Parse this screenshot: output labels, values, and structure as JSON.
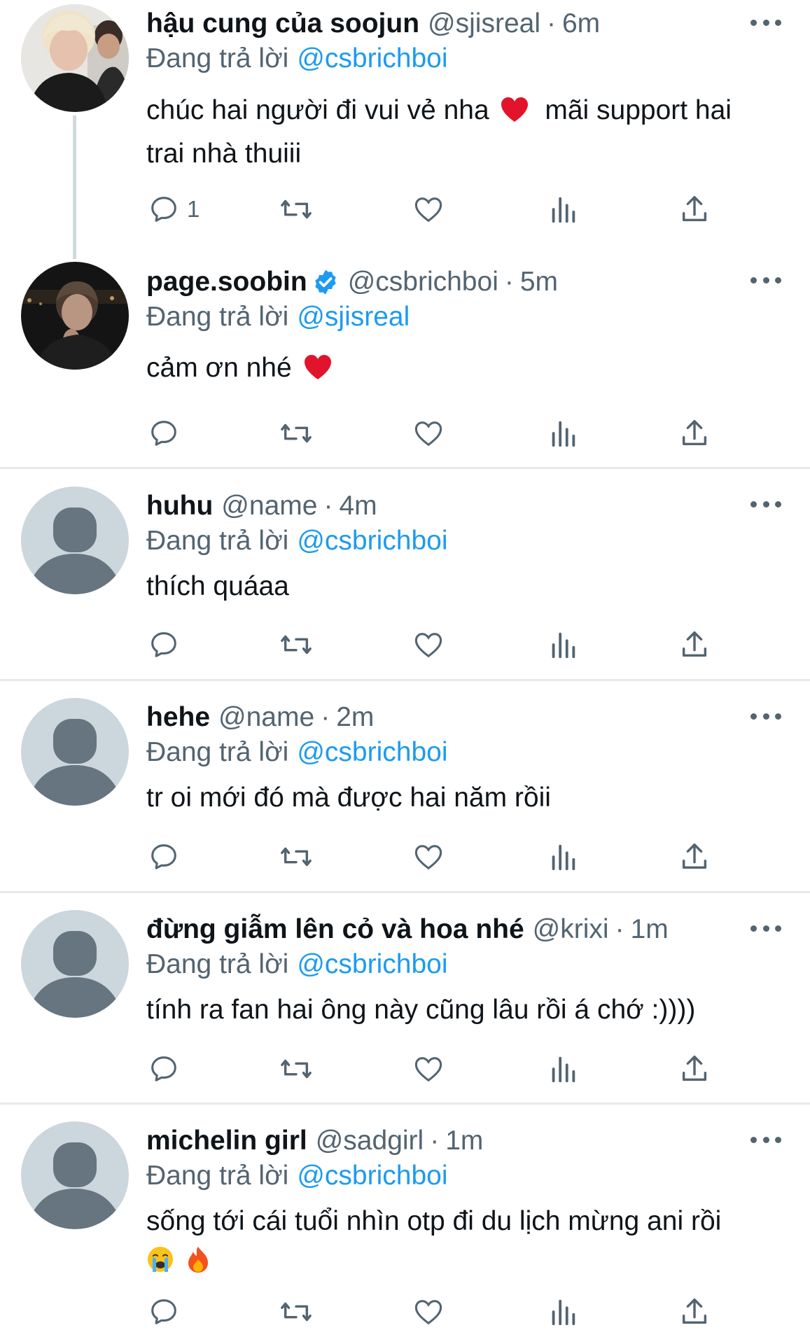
{
  "colors": {
    "accent": "#1d9bf0",
    "text": "#0f1419",
    "secondary": "#536471",
    "divider": "#e7e9ea",
    "thread_line": "#cfd9de",
    "default_avatar_bg": "#ccd6dd",
    "default_avatar_fg": "#66757f"
  },
  "tweets": [
    {
      "name": "hậu cung của soojun",
      "handle": "@sjisreal",
      "sep": "·",
      "time": "6m",
      "replying_label": "Đang trả lời",
      "replying_to": "@csbrichboi",
      "text_line1": "chúc hai người đi vui vẻ nha",
      "text_emoji": "❤️",
      "text_line1b": "mãi support hai",
      "text_line2": "trai nhà thuiii",
      "reply_count": "1",
      "avatar": "photo"
    },
    {
      "name": "page.soobin",
      "verified": true,
      "handle": "@csbrichboi",
      "sep": "·",
      "time": "5m",
      "replying_label": "Đang trả lời",
      "replying_to": "@sjisreal",
      "text_line1": "cảm ơn nhé",
      "text_emoji": "❤️",
      "avatar": "photo-dark"
    },
    {
      "name": "huhu",
      "handle": "@name",
      "sep": "·",
      "time": "4m",
      "replying_label": "Đang trả lời",
      "replying_to": "@csbrichboi",
      "text_line1": "thích quáaa",
      "avatar": "default"
    },
    {
      "name": "hehe",
      "handle": "@name",
      "sep": "·",
      "time": "2m",
      "replying_label": "Đang trả lời",
      "replying_to": "@csbrichboi",
      "text_line1": "tr oi mới đó mà được hai năm rồii",
      "avatar": "default"
    },
    {
      "name": "đừng giẫm lên cỏ và hoa nhé",
      "handle": "@krixi",
      "sep": "·",
      "time": "1m",
      "replying_label": "Đang trả lời",
      "replying_to": "@csbrichboi",
      "text_line1": "tính ra fan hai ông này cũng lâu rồi á chớ :))))",
      "avatar": "default"
    },
    {
      "name": "michelin girl",
      "handle": "@sadgirl",
      "sep": "·",
      "time": "1m",
      "replying_label": "Đang trả lời",
      "replying_to": "@csbrichboi",
      "text_line1": "sống tới cái tuổi nhìn otp đi du lịch mừng ani rồi",
      "text_emoji_line2": "😭 🔥",
      "avatar": "default"
    }
  ],
  "icons": {
    "reply": "reply-icon",
    "retweet": "retweet-icon",
    "like": "like-icon",
    "views": "views-icon",
    "share": "share-icon",
    "more": "more-icon",
    "verified": "verified-badge-icon"
  }
}
